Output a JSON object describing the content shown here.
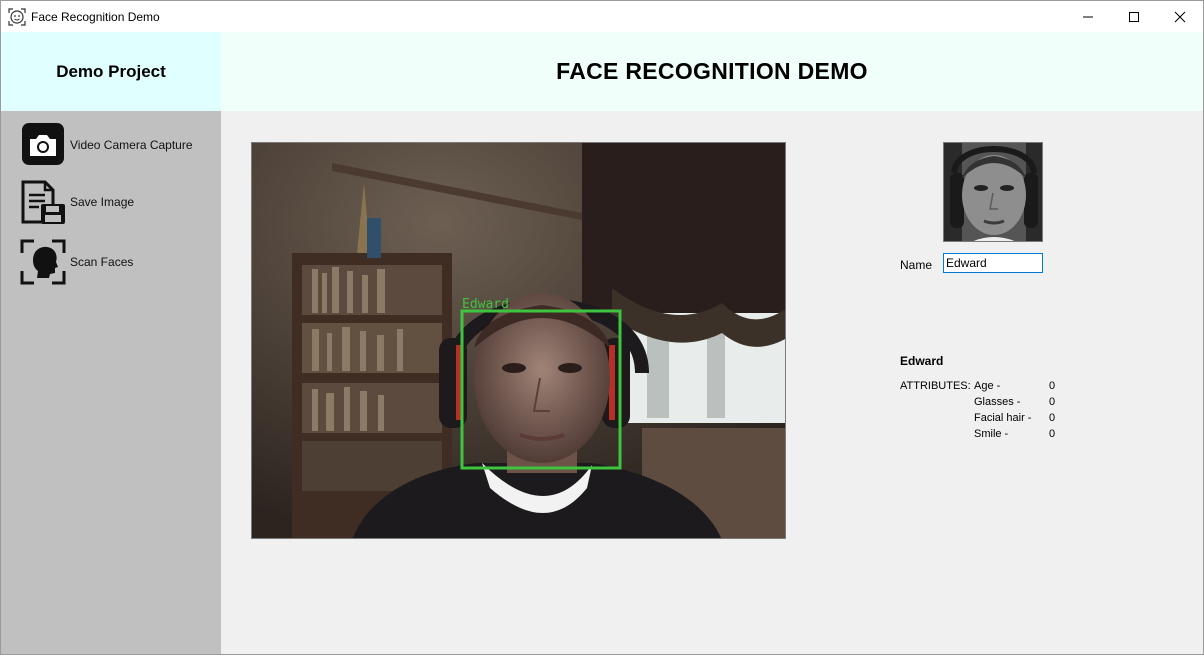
{
  "window": {
    "title": "Face Recognition Demo"
  },
  "sidebar": {
    "brand": "Demo Project",
    "items": [
      {
        "label": "Video Camera Capture",
        "icon": "camera-icon"
      },
      {
        "label": "Save Image",
        "icon": "save-document-icon"
      },
      {
        "label": "Scan Faces",
        "icon": "face-scan-icon"
      }
    ]
  },
  "header": {
    "title": "FACE RECOGNITION DEMO"
  },
  "video": {
    "detection_label": "Edward",
    "box_color": "#3ec43e"
  },
  "profile": {
    "name_label": "Name",
    "name_value": "Edward",
    "person_name": "Edward",
    "attributes_title": "ATTRIBUTES:",
    "attributes": [
      {
        "key": "Age -",
        "value": "0"
      },
      {
        "key": "Glasses -",
        "value": "0"
      },
      {
        "key": "Facial hair -",
        "value": "0"
      },
      {
        "key": "Smile -",
        "value": "0"
      }
    ]
  }
}
